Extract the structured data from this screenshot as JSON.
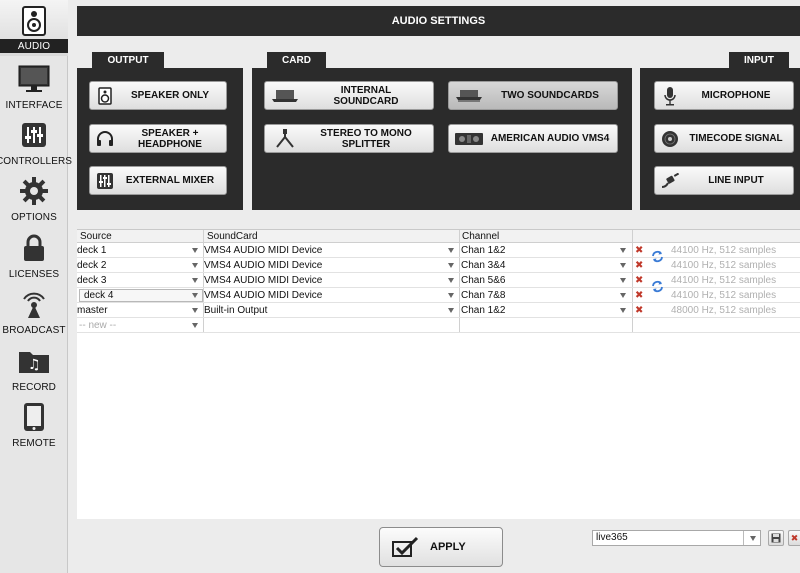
{
  "sidebar": {
    "items": [
      {
        "label": "AUDIO",
        "icon": "speaker-icon",
        "active": true
      },
      {
        "label": "INTERFACE",
        "icon": "monitor-icon"
      },
      {
        "label": "CONTROLLERS",
        "icon": "faders-icon"
      },
      {
        "label": "OPTIONS",
        "icon": "gear-icon"
      },
      {
        "label": "LICENSES",
        "icon": "lock-icon"
      },
      {
        "label": "BROADCAST",
        "icon": "broadcast-icon"
      },
      {
        "label": "RECORD",
        "icon": "record-folder-icon"
      },
      {
        "label": "REMOTE",
        "icon": "tablet-icon"
      }
    ]
  },
  "header": {
    "title": "AUDIO SETTINGS"
  },
  "output": {
    "label": "OUTPUT",
    "buttons": {
      "speaker_only": "SPEAKER ONLY",
      "speaker_headphone_1": "SPEAKER +",
      "speaker_headphone_2": "HEADPHONE",
      "external_mixer": "EXTERNAL MIXER"
    }
  },
  "card": {
    "label": "CARD",
    "buttons": {
      "internal_1": "INTERNAL",
      "internal_2": "SOUNDCARD",
      "two_soundcards": "TWO SOUNDCARDS",
      "stereo_mono_1": "STEREO TO MONO",
      "stereo_mono_2": "SPLITTER",
      "american_audio": "AMERICAN AUDIO VMS4"
    },
    "selected": "TWO SOUNDCARDS"
  },
  "input": {
    "label": "INPUT",
    "buttons": {
      "microphone": "MICROPHONE",
      "timecode": "TIMECODE SIGNAL",
      "line_input": "LINE INPUT"
    }
  },
  "table": {
    "headers": {
      "source": "Source",
      "soundcard": "SoundCard",
      "channel": "Channel"
    },
    "rows": [
      {
        "source": "deck 1",
        "soundcard": "VMS4 AUDIO MIDI Device",
        "channel": "Chan 1&2",
        "rate": "44100 Hz, 512 samples"
      },
      {
        "source": "deck 2",
        "soundcard": "VMS4 AUDIO MIDI Device",
        "channel": "Chan 3&4",
        "rate": "44100 Hz, 512 samples"
      },
      {
        "source": "deck 3",
        "soundcard": "VMS4 AUDIO MIDI Device",
        "channel": "Chan 5&6",
        "rate": "44100 Hz, 512 samples"
      },
      {
        "source": "deck 4",
        "soundcard": "VMS4 AUDIO MIDI Device",
        "channel": "Chan 7&8",
        "rate": "44100 Hz, 512 samples"
      },
      {
        "source": "master",
        "soundcard": "Built-in Output",
        "channel": "Chan 1&2",
        "rate": "48000 Hz, 512 samples"
      }
    ],
    "new_row": "-- new --",
    "remove_glyph": "✖"
  },
  "footer": {
    "apply_label": "APPLY",
    "preset_value": "live365"
  },
  "colors": {
    "panel": "#2b2b2b",
    "accent_remove": "#c0392b",
    "refresh": "#3a7bd5"
  }
}
